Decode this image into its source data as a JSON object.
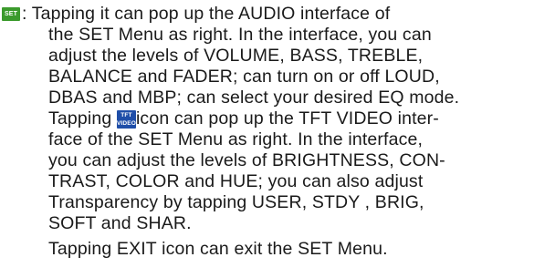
{
  "icons": {
    "set_label": "SET",
    "tft_label_top": "TFT",
    "tft_label_bottom": "VIDEO",
    "set_color": "#3b9a2c",
    "tft_color": "#1f4ea8"
  },
  "text": {
    "line1": ": Tapping it can pop up the AUDIO interface of",
    "line2": "the SET Menu as right. In the interface, you can",
    "line3": "adjust the levels of VOLUME, BASS, TREBLE,",
    "line4": "BALANCE and FADER; can turn on or off LOUD,",
    "line5": "DBAS and MBP; can select your desired EQ mode.",
    "line6_before": "Tapping",
    "line6_after": "icon can pop up the TFT VIDEO inter-",
    "line7": "face of the SET Menu as right. In the interface,",
    "line8": "you can adjust the levels of BRIGHTNESS, CON-",
    "line9": "TRAST, COLOR and HUE; you can also adjust",
    "line10": "Transparency by tapping USER, STDY , BRIG,",
    "line11": "SOFT and SHAR.",
    "line12": "Tapping EXIT icon can exit the SET Menu."
  }
}
